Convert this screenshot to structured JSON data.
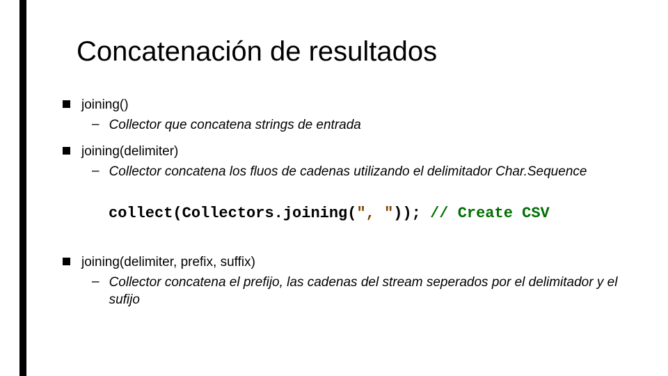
{
  "title": "Concatenación de resultados",
  "bullets": {
    "b1": {
      "label": "joining()",
      "sub": "Collector que concatena strings de entrada"
    },
    "b2": {
      "label": "joining(delimiter)",
      "sub": "Collector concatena los fluos de cadenas utilizando el delimitador Char.Sequence"
    },
    "b3": {
      "label": "joining(delimiter, prefix, suffix)",
      "sub": "Collector concatena el prefijo, las cadenas del stream seperados por el delimitador y el sufijo"
    }
  },
  "code": {
    "t1": "collect(",
    "t2": "Collectors.joining",
    "t3": "(",
    "t4": "\", \"",
    "t5": "));",
    "t6": " // Create CSV"
  }
}
